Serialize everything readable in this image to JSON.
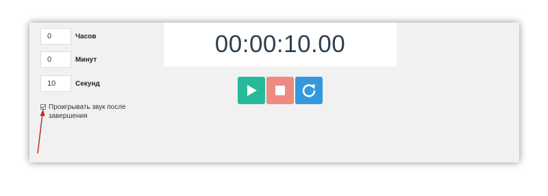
{
  "fields": {
    "hours": {
      "value": "0",
      "label": "Часов"
    },
    "minutes": {
      "value": "0",
      "label": "Минут"
    },
    "seconds": {
      "value": "10",
      "label": "Секунд"
    }
  },
  "sound_option": {
    "label": "Проигрывать звук после завершения",
    "checked": true
  },
  "timer": {
    "display": "00:00:10.00"
  },
  "controls": {
    "play": {
      "icon": "play-icon",
      "color": "#26b99a"
    },
    "stop": {
      "icon": "stop-icon",
      "color": "#ee8a7f"
    },
    "reset": {
      "icon": "reset-icon",
      "color": "#3598dc"
    }
  },
  "annotation": {
    "arrow_color": "#c62828"
  }
}
